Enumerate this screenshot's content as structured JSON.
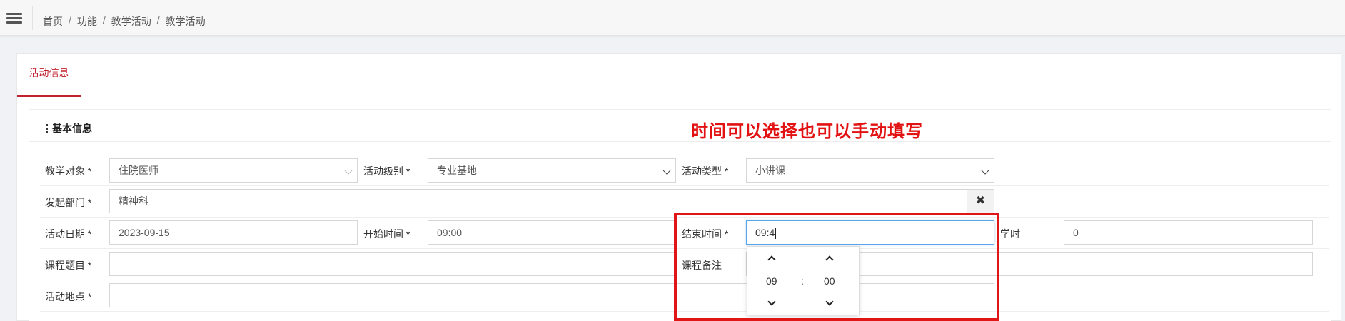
{
  "breadcrumb": [
    "首页",
    "功能",
    "教学活动",
    "教学活动"
  ],
  "breadcrumb_separator": "/",
  "tab": {
    "label": "活动信息"
  },
  "section": {
    "title": "基本信息"
  },
  "annotation": {
    "text": "时间可以选择也可以手动填写",
    "color": "#e21212"
  },
  "form": {
    "target": {
      "label": "教学对象 *",
      "value": "住院医师"
    },
    "level": {
      "label": "活动级别 *",
      "value": "专业基地"
    },
    "type": {
      "label": "活动类型 *",
      "value": "小讲课"
    },
    "department": {
      "label": "发起部门 *",
      "value": "精神科",
      "clear_icon": "✖"
    },
    "date": {
      "label": "活动日期 *",
      "value": "2023-09-15"
    },
    "start_time": {
      "label": "开始时间 *",
      "value": "09:00"
    },
    "end_time": {
      "label": "结束时间 *",
      "value": "09:4"
    },
    "hours": {
      "label": "学时",
      "value": "0"
    },
    "course_title": {
      "label": "课程题目 *",
      "value": ""
    },
    "course_note": {
      "label": "课程备注",
      "value": ""
    },
    "location": {
      "label": "活动地点 *",
      "value": ""
    }
  },
  "time_picker": {
    "hour": "09",
    "separator": ":",
    "minute": "00"
  },
  "colors": {
    "accent": "#c0222e",
    "highlight_border": "#e01616",
    "focus_border": "#5aa6e8"
  }
}
